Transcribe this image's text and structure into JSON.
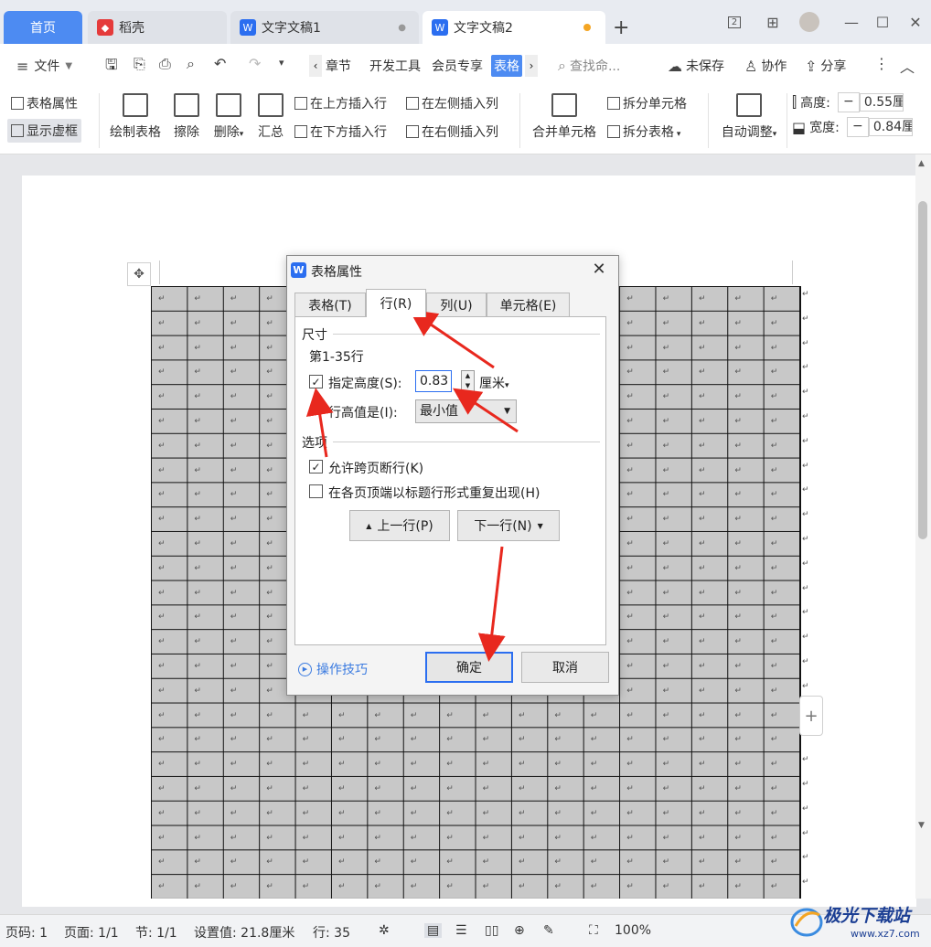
{
  "tabs": [
    {
      "label": "首页"
    },
    {
      "label": "稻壳"
    },
    {
      "label": "文字文稿1"
    },
    {
      "label": "文字文稿2"
    }
  ],
  "window_controls": {
    "badge": "2"
  },
  "menu": {
    "file": "文件",
    "items": [
      "章节",
      "开发工具",
      "会员专享",
      "表格"
    ],
    "search_placeholder": "查找命...",
    "unsaved": "未保存",
    "collab": "协作",
    "share": "分享"
  },
  "ribbon": {
    "table_props": "表格属性",
    "show_virtual": "显示虚框",
    "draw_table": "绘制表格",
    "erase": "擦除",
    "delete": "删除",
    "summary": "汇总",
    "insert_above": "在上方插入行",
    "insert_below": "在下方插入行",
    "insert_left": "在左侧插入列",
    "insert_right": "在右侧插入列",
    "merge_cells": "合并单元格",
    "split_cells": "拆分单元格",
    "split_table": "拆分表格",
    "auto_adjust": "自动调整",
    "height_label": "高度:",
    "height_value": "0.55厘",
    "width_label": "宽度:",
    "width_value": "0.84厘",
    "minus": "−"
  },
  "dialog": {
    "title": "表格属性",
    "tabs": [
      "表格(T)",
      "行(R)",
      "列(U)",
      "单元格(E)"
    ],
    "active_tab": 1,
    "size_group": "尺寸",
    "rows_range": "第1-35行",
    "specify_height": "指定高度(S):",
    "specify_height_checked": true,
    "height_value": "0.83",
    "unit": "厘米",
    "row_height_is": "行高值是(I):",
    "row_height_option": "最小值",
    "options_group": "选项",
    "allow_break": "允许跨页断行(K)",
    "allow_break_checked": true,
    "repeat_header": "在各页顶端以标题行形式重复出现(H)",
    "repeat_header_checked": false,
    "prev_row": "上一行(P)",
    "next_row": "下一行(N)",
    "tips": "操作技巧",
    "ok": "确定",
    "cancel": "取消"
  },
  "table": {
    "rows": 25,
    "cols": 18,
    "mark": "↵"
  },
  "status": {
    "page_code": "页码: 1",
    "pages": "页面: 1/1",
    "section": "节: 1/1",
    "setting": "设置值: 21.8厘米",
    "row": "行: 35",
    "zoom": "100%"
  },
  "watermark": {
    "text": "极光下载站",
    "url": "www.xz7.com"
  },
  "colors": {
    "accent": "#4d8bf2",
    "arrow": "#e8281e"
  }
}
